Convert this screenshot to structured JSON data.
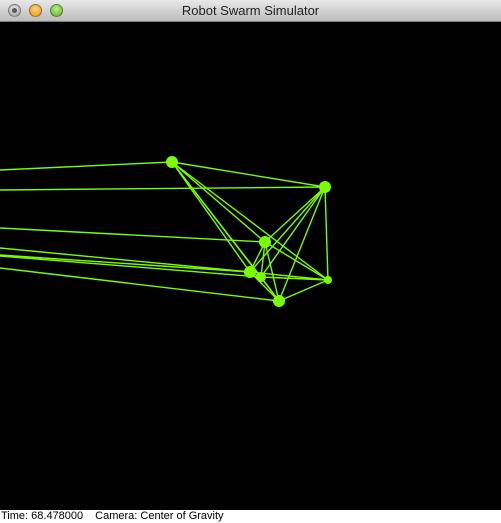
{
  "window": {
    "title": "Robot Swarm Simulator"
  },
  "scene": {
    "line_color": "#7cfc00",
    "node_color": "#7cfc00",
    "background": "#000000"
  },
  "status": {
    "time_label": "Time: 68.478000",
    "camera_label": "Camera: Center of Gravity"
  }
}
